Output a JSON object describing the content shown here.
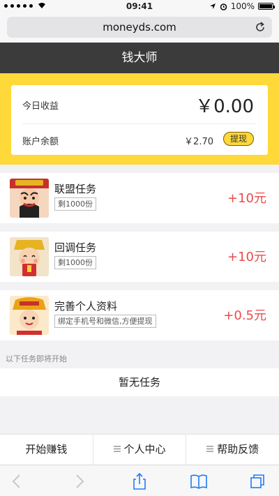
{
  "status_bar": {
    "time": "09:41",
    "battery": "100%"
  },
  "browser": {
    "url": "moneyds.com"
  },
  "header": {
    "title": "钱大师"
  },
  "earnings": {
    "today_label": "今日收益",
    "today_value": "￥0.00",
    "balance_label": "账户余额",
    "balance_value": "￥2.70",
    "withdraw_label": "提现"
  },
  "tasks": [
    {
      "name": "联盟任务",
      "tag": "剩1000份",
      "reward": "+10元",
      "icon": "god-of-wealth-avatar-1"
    },
    {
      "name": "回调任务",
      "tag": "剩1000份",
      "reward": "+10元",
      "icon": "god-of-wealth-avatar-2"
    },
    {
      "name": "完善个人资料",
      "tag": "绑定手机号和微信,方便提现",
      "reward": "+0.5元",
      "icon": "god-of-wealth-avatar-3"
    }
  ],
  "upcoming": {
    "label": "以下任务即将开始",
    "empty_text": "暂无任务"
  },
  "bottom_nav": {
    "start": "开始赚钱",
    "profile": "个人中心",
    "help": "帮助反馈"
  },
  "colors": {
    "accent_yellow": "#ffd83a",
    "header_dark": "#3b3b3b",
    "reward_red": "#e94b4b"
  }
}
